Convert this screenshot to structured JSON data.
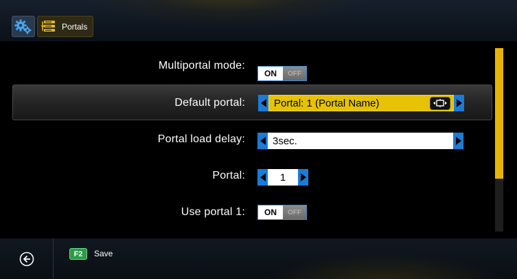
{
  "header": {
    "settings_icon": "gear-icon",
    "breadcrumb": {
      "icon": "portal-list-icon",
      "label": "Portals"
    }
  },
  "rows": [
    {
      "label": "Multiportal mode:",
      "type": "toggle",
      "on_label": "ON",
      "off_label": "OFF",
      "value": "ON"
    },
    {
      "label": "Default portal:",
      "type": "select",
      "value": "Portal: 1 (Portal Name)",
      "icon": "keyboard-icon",
      "selected": true
    },
    {
      "label": "Portal load delay:",
      "type": "select",
      "value": "3sec."
    },
    {
      "label": "Portal:",
      "type": "number",
      "value": "1"
    },
    {
      "label": "Use portal 1:",
      "type": "toggle",
      "on_label": "ON",
      "off_label": "OFF",
      "value": "ON"
    }
  ],
  "footer": {
    "back_icon": "back-arrow-icon",
    "key": "F2",
    "save_label": "Save"
  },
  "colors": {
    "accent_blue": "#1a7cd6",
    "highlight_yellow": "#e6c200",
    "scroll_yellow": "#e9b400",
    "key_green": "#2c9a48"
  }
}
